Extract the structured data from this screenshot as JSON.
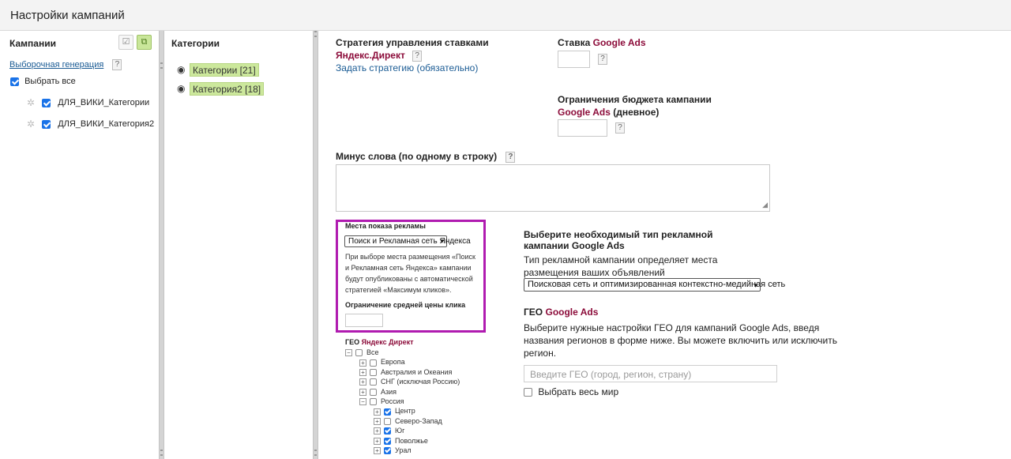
{
  "page_title": "Настройки кампаний",
  "left": {
    "header": "Кампании",
    "selective_generation_link": "Выборочная генерация",
    "help": "?",
    "select_all": "Выбрать все",
    "campaigns": [
      {
        "name": "ДЛЯ_ВИКИ_Категории",
        "checked": true
      },
      {
        "name": "ДЛЯ_ВИКИ_Категория2",
        "checked": true
      }
    ]
  },
  "middle": {
    "header": "Категории",
    "categories": [
      {
        "label": "Категории [21]"
      },
      {
        "label": "Категория2 [18]"
      }
    ]
  },
  "right": {
    "strategy_title": "Стратегия управления ставками",
    "yandex_direct": "Яндекс.Директ",
    "set_strategy_link": "Задать стратегию (обязательно)",
    "google_bid_label": "Ставка",
    "google_ads": "Google Ads",
    "budget_title": "Ограничения бюджета кампании",
    "budget_suffix": "(дневное)",
    "minus_words_label": "Минус слова (по одному в строку)",
    "ad_places": {
      "title": "Места показа рекламы",
      "selected": "Поиск и Рекламная сеть Яндекса",
      "note": "При выборе места размещения «Поиск и Рекламная сеть Яндекса» кампании будут опубликованы с автоматической стратегией «Максимум кликов».",
      "cpc_limit_label": "Ограничение средней цены клика"
    },
    "yandex_geo": {
      "title": "ГЕО",
      "brand": "Яндекс Директ",
      "tree": [
        {
          "label": "Все",
          "level": 0,
          "checked": false,
          "sign": "−"
        },
        {
          "label": "Европа",
          "level": 1,
          "checked": false,
          "sign": "+"
        },
        {
          "label": "Австралия и Океания",
          "level": 1,
          "checked": false,
          "sign": "+"
        },
        {
          "label": "СНГ (исключая Россию)",
          "level": 1,
          "checked": false,
          "sign": "+"
        },
        {
          "label": "Азия",
          "level": 1,
          "checked": false,
          "sign": "+"
        },
        {
          "label": "Россия",
          "level": 1,
          "checked": false,
          "sign": "−"
        },
        {
          "label": "Центр",
          "level": 2,
          "checked": true,
          "sign": "+"
        },
        {
          "label": "Северо-Запад",
          "level": 2,
          "checked": false,
          "sign": "+"
        },
        {
          "label": "Юг",
          "level": 2,
          "checked": true,
          "sign": "+"
        },
        {
          "label": "Поволжье",
          "level": 2,
          "checked": true,
          "sign": "+"
        },
        {
          "label": "Урал",
          "level": 2,
          "checked": true,
          "sign": "+"
        }
      ]
    },
    "google_type": {
      "title_line1": "Выберите необходимый тип рекламной",
      "title_line2": "кампании Google Ads",
      "desc_line1": "Тип рекламной кампании определяет места",
      "desc_line2": "размещения ваших объявлений",
      "selected": "Поисковая сеть и оптимизированная контекстно-медийная сеть"
    },
    "google_geo": {
      "title": "ГЕО",
      "brand": "Google Ads",
      "desc_line1": "Выберите нужные настройки ГЕО для кампаний Google Ads, введя",
      "desc_line2": "названия регионов в форме ниже. Вы можете включить или исключить",
      "desc_line3": "регион.",
      "placeholder": "Введите ГЕО (город, регион, страну)",
      "select_world": "Выбрать весь мир"
    }
  }
}
